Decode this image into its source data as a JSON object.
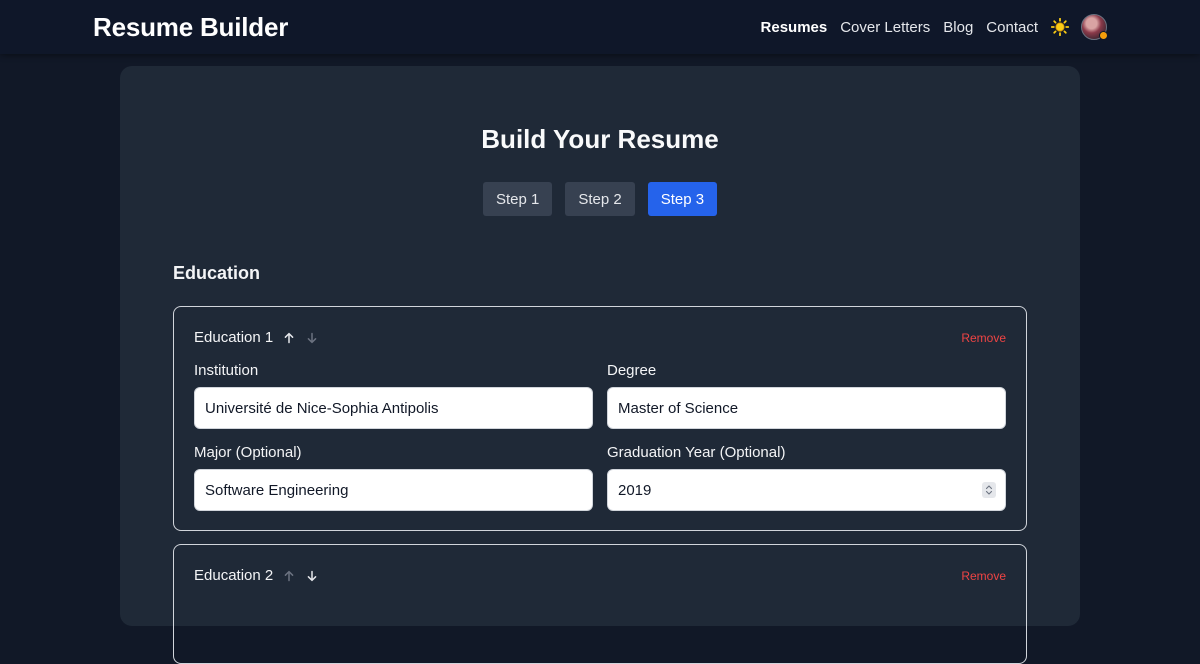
{
  "header": {
    "brand": "Resume Builder",
    "nav": [
      {
        "label": "Resumes",
        "active": true
      },
      {
        "label": "Cover Letters"
      },
      {
        "label": "Blog"
      },
      {
        "label": "Contact"
      }
    ],
    "theme_icon": "sun-icon",
    "avatar_icon": "user-avatar"
  },
  "main": {
    "title": "Build Your Resume",
    "steps": [
      {
        "label": "Step 1"
      },
      {
        "label": "Step 2"
      },
      {
        "label": "Step 3",
        "active": true
      }
    ],
    "section_title": "Education",
    "remove_label": "Remove",
    "education": [
      {
        "label": "Education 1",
        "fields": {
          "institution_label": "Institution",
          "institution_value": "Université de Nice-Sophia Antipolis",
          "degree_label": "Degree",
          "degree_value": "Master of Science",
          "major_label": "Major (Optional)",
          "major_value": "Software Engineering",
          "year_label": "Graduation Year (Optional)",
          "year_value": "2019"
        }
      },
      {
        "label": "Education 2"
      }
    ]
  },
  "colors": {
    "accent": "#2563eb",
    "danger": "#ef4444",
    "card": "#1f2937",
    "background": "#111827"
  }
}
